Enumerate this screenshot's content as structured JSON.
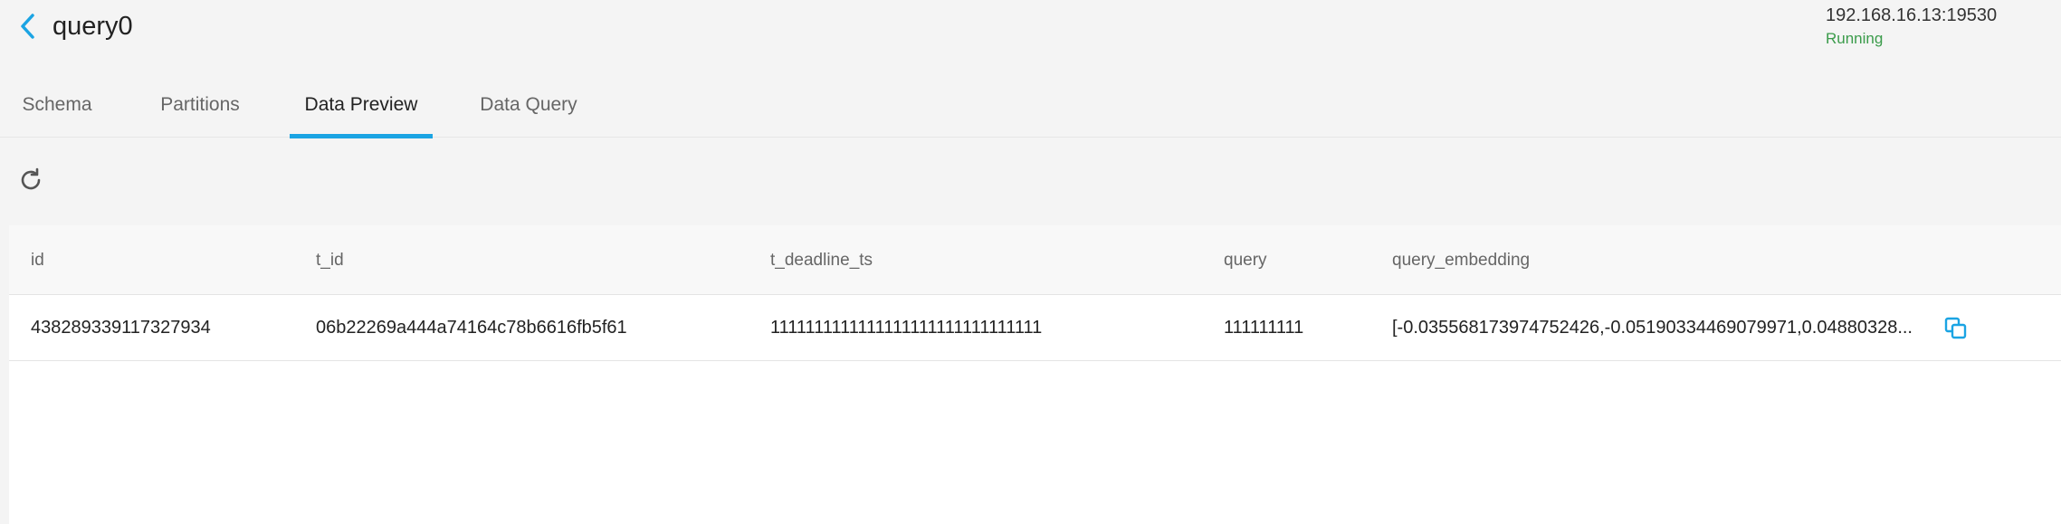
{
  "header": {
    "title": "query0",
    "server_address": "192.168.16.13:19530",
    "server_status": "Running"
  },
  "tabs": [
    {
      "label": "Schema",
      "active": false
    },
    {
      "label": "Partitions",
      "active": false
    },
    {
      "label": "Data Preview",
      "active": true
    },
    {
      "label": "Data Query",
      "active": false
    }
  ],
  "table": {
    "columns": [
      "id",
      "t_id",
      "t_deadline_ts",
      "query",
      "query_embedding"
    ],
    "rows": [
      {
        "id": "438289339117327934",
        "t_id": "06b22269a444a74164c78b6616fb5f61",
        "t_deadline_ts": "1111111111111111111111111111111",
        "query": "111111111",
        "query_embedding": "[-0.035568173974752426,-0.05190334469079971,0.04880328..."
      }
    ]
  },
  "colors": {
    "accent": "#1ba4e3",
    "status_running": "#3a9b4a"
  },
  "icons": {
    "back": "chevron-left-icon",
    "refresh": "refresh-icon",
    "copy": "copy-icon"
  }
}
